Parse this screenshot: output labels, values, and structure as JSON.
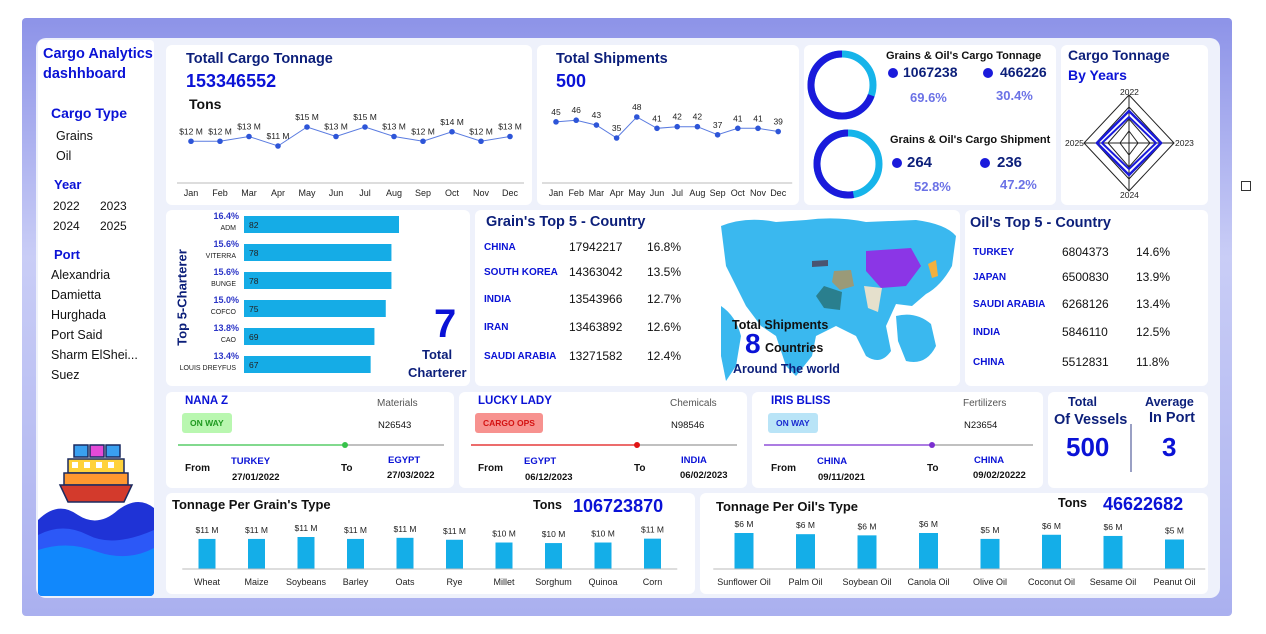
{
  "sidebar": {
    "title_line1": "Cargo Analytics",
    "title_line2": "dashhboard",
    "cargo_type_label": "Cargo Type",
    "cargo_types": [
      "Grains",
      "Oil"
    ],
    "year_label": "Year",
    "years": [
      "2022",
      "2023",
      "2024",
      "2025"
    ],
    "port_label": "Port",
    "ports": [
      "Alexandria",
      "Damietta",
      "Hurghada",
      "Port Said",
      "Sharm ElShei...",
      "Suez"
    ]
  },
  "tonnage": {
    "title": "Totall Cargo Tonnage",
    "value": "153346552",
    "unit": "Tons",
    "months": [
      "Jan",
      "Feb",
      "Mar",
      "Apr",
      "May",
      "Jun",
      "Jul",
      "Aug",
      "Sep",
      "Oct",
      "Nov",
      "Dec"
    ],
    "point_labels": [
      "$12 M",
      "$12 M",
      "$13 M",
      "$11 M",
      "$15 M",
      "$13 M",
      "$15 M",
      "$13 M",
      "$12 M",
      "$14 M",
      "$12 M",
      "$13 M"
    ]
  },
  "shipments": {
    "title": "Total Shipments",
    "value": "500",
    "months": [
      "Jan",
      "Feb",
      "Mar",
      "Apr",
      "May",
      "Jun",
      "Jul",
      "Aug",
      "Sep",
      "Oct",
      "Nov",
      "Dec"
    ],
    "point_labels": [
      "45",
      "46",
      "43",
      "35",
      "48",
      "41",
      "42",
      "42",
      "37",
      "41",
      "41",
      "39"
    ]
  },
  "donuts": {
    "tonnage_title": "Grains & Oil's Cargo Tonnage",
    "tonnage_grains": "1067238",
    "tonnage_oil": "466226",
    "tonnage_grains_pct": "69.6%",
    "tonnage_oil_pct": "30.4%",
    "shipment_title": "Grains & Oil's Cargo Shipment",
    "shipment_grains": "264",
    "shipment_oil": "236",
    "shipment_grains_pct": "52.8%",
    "shipment_oil_pct": "47.2%",
    "colors": {
      "grains": "#1a1adb",
      "oil": "#16b4ea"
    }
  },
  "years_radar": {
    "title_line1": "Cargo Tonnage",
    "title_line2": "By Years",
    "labels": [
      "2022",
      "2023",
      "2024",
      "2025"
    ]
  },
  "charterer": {
    "axis_title": "Top 5-Charterer",
    "rows": [
      {
        "pct": "16.4%",
        "name": "ADM",
        "value": "82"
      },
      {
        "pct": "15.6%",
        "name": "VITERRA",
        "value": "78"
      },
      {
        "pct": "15.6%",
        "name": "BUNGE",
        "value": "78"
      },
      {
        "pct": "15.0%",
        "name": "COFCO",
        "value": "75"
      },
      {
        "pct": "13.8%",
        "name": "CAO",
        "value": "69"
      },
      {
        "pct": "13.4%",
        "name": "LOUIS DREYFUS",
        "value": "67"
      }
    ],
    "total_value": "7",
    "total_label_line1": "Total",
    "total_label_line2": "Charterer"
  },
  "grain_top": {
    "title": "Grain's Top 5 - Country",
    "rows": [
      {
        "country": "CHINA",
        "value": "17942217",
        "pct": "16.8%"
      },
      {
        "country": "SOUTH KOREA",
        "value": "14363042",
        "pct": "13.5%"
      },
      {
        "country": "INDIA",
        "value": "13543966",
        "pct": "12.7%"
      },
      {
        "country": "IRAN",
        "value": "13463892",
        "pct": "12.6%"
      },
      {
        "country": "SAUDI ARABIA",
        "value": "13271582",
        "pct": "12.4%"
      }
    ]
  },
  "map": {
    "line1": "Total Shipments",
    "count": "8",
    "count_label": "Countries",
    "line3": "Around The world"
  },
  "oil_top": {
    "title": "Oil's Top 5 - Country",
    "rows": [
      {
        "country": "TURKEY",
        "value": "6804373",
        "pct": "14.6%"
      },
      {
        "country": "JAPAN",
        "value": "6500830",
        "pct": "13.9%"
      },
      {
        "country": "SAUDI ARABIA",
        "value": "6268126",
        "pct": "13.4%"
      },
      {
        "country": "INDIA",
        "value": "5846110",
        "pct": "12.5%"
      },
      {
        "country": "CHINA",
        "value": "5512831",
        "pct": "11.8%"
      }
    ]
  },
  "vessels": [
    {
      "name": "NANA Z",
      "category": "Materials",
      "status": "ON WAY",
      "id": "N26543",
      "from_label": "From",
      "from": "TURKEY",
      "from_date": "27/01/2022",
      "to_label": "To",
      "to": "EGYPT",
      "to_date": "27/03/2022",
      "color": "#37c24a"
    },
    {
      "name": "LUCKY LADY",
      "category": "Chemicals",
      "status": "CARGO OPS",
      "id": "N98546",
      "from_label": "From",
      "from": "EGYPT",
      "from_date": "06/12/2023",
      "to_label": "To",
      "to": "INDIA",
      "to_date": "06/02/2023",
      "color": "#e11414"
    },
    {
      "name": "IRIS BLISS",
      "category": "Fertilizers",
      "status": "ON WAY",
      "id": "N23654",
      "from_label": "From",
      "from": "CHINA",
      "from_date": "09/11/2021",
      "to_label": "To",
      "to": "CHINA",
      "to_date": "09/02/20222",
      "color": "#7b2fd0"
    }
  ],
  "kpis": {
    "total_label_line1": "Total",
    "total_label_line2": "Of Vessels",
    "total_value": "500",
    "avg_label_line1": "Average",
    "avg_label_line2": "In Port",
    "avg_value": "3"
  },
  "grain_types": {
    "title": "Tonnage Per Grain's Type",
    "tons_label": "Tons",
    "tons_value": "106723870",
    "categories": [
      "Wheat",
      "Maize",
      "Soybeans",
      "Barley",
      "Oats",
      "Rye",
      "Millet",
      "Sorghum",
      "Quinoa",
      "Corn"
    ],
    "labels": [
      "$11 M",
      "$11 M",
      "$11 M",
      "$11 M",
      "$11 M",
      "$11 M",
      "$10 M",
      "$10 M",
      "$10 M",
      "$11 M"
    ],
    "values": [
      10.9,
      10.9,
      11.6,
      10.9,
      11.3,
      10.6,
      9.6,
      9.4,
      9.6,
      11.0
    ]
  },
  "oil_types": {
    "title": "Tonnage Per Oil's Type",
    "tons_label": "Tons",
    "tons_value": "46622682",
    "categories": [
      "Sunflower Oil",
      "Palm Oil",
      "Soybean Oil",
      "Canola Oil",
      "Olive Oil",
      "Coconut Oil",
      "Sesame Oil",
      "Peanut Oil"
    ],
    "labels": [
      "$6 M",
      "$6 M",
      "$6 M",
      "$6 M",
      "$5 M",
      "$6 M",
      "$6 M",
      "$5 M"
    ],
    "values": [
      6.1,
      5.9,
      5.7,
      6.1,
      5.1,
      5.8,
      5.6,
      5.0
    ]
  },
  "chart_data": [
    {
      "type": "line",
      "title": "Totall Cargo Tonnage",
      "x": [
        "Jan",
        "Feb",
        "Mar",
        "Apr",
        "May",
        "Jun",
        "Jul",
        "Aug",
        "Sep",
        "Oct",
        "Nov",
        "Dec"
      ],
      "series": [
        {
          "values": [
            12,
            12,
            13,
            11,
            15,
            13,
            15,
            13,
            12,
            14,
            12,
            13
          ]
        }
      ],
      "data_labels": [
        "$12 M",
        "$12 M",
        "$13 M",
        "$11 M",
        "$15 M",
        "$13 M",
        "$15 M",
        "$13 M",
        "$12 M",
        "$14 M",
        "$12 M",
        "$13 M"
      ],
      "grid": false
    },
    {
      "type": "line",
      "title": "Total Shipments",
      "x": [
        "Jan",
        "Feb",
        "Mar",
        "Apr",
        "May",
        "Jun",
        "Jul",
        "Aug",
        "Sep",
        "Oct",
        "Nov",
        "Dec"
      ],
      "series": [
        {
          "values": [
            45,
            46,
            43,
            35,
            48,
            41,
            42,
            42,
            37,
            41,
            41,
            39
          ]
        }
      ],
      "grid": false
    },
    {
      "type": "pie",
      "title": "Grains & Oil's Cargo Tonnage",
      "values": [
        1067238,
        466226
      ],
      "percent_labels": [
        "69.6%",
        "30.4%"
      ]
    },
    {
      "type": "pie",
      "title": "Grains & Oil's Cargo Shipment",
      "values": [
        264,
        236
      ],
      "percent_labels": [
        "52.8%",
        "47.2%"
      ]
    },
    {
      "type": "bar",
      "title": "Top 5-Charterer",
      "categories": [
        "ADM",
        "VITERRA",
        "BUNGE",
        "COFCO",
        "CAO",
        "LOUIS DREYFUS"
      ],
      "values": [
        82,
        78,
        78,
        75,
        69,
        67
      ],
      "percent_labels": [
        "16.4%",
        "15.6%",
        "15.6%",
        "15.0%",
        "13.8%",
        "13.4%"
      ],
      "orientation": "horizontal"
    },
    {
      "type": "bar",
      "title": "Tonnage Per Grain's Type",
      "categories": [
        "Wheat",
        "Maize",
        "Soybeans",
        "Barley",
        "Oats",
        "Rye",
        "Millet",
        "Sorghum",
        "Quinoa",
        "Corn"
      ],
      "values": [
        10.9,
        10.9,
        11.6,
        10.9,
        11.3,
        10.6,
        9.6,
        9.4,
        9.6,
        11.0
      ],
      "data_labels": [
        "$11 M",
        "$11 M",
        "$11 M",
        "$11 M",
        "$11 M",
        "$11 M",
        "$10 M",
        "$10 M",
        "$10 M",
        "$11 M"
      ]
    },
    {
      "type": "bar",
      "title": "Tonnage Per Oil's Type",
      "categories": [
        "Sunflower Oil",
        "Palm Oil",
        "Soybean Oil",
        "Canola Oil",
        "Olive Oil",
        "Coconut Oil",
        "Sesame Oil",
        "Peanut Oil"
      ],
      "values": [
        6.1,
        5.9,
        5.7,
        6.1,
        5.1,
        5.8,
        5.6,
        5.0
      ],
      "data_labels": [
        "$6 M",
        "$6 M",
        "$6 M",
        "$6 M",
        "$5 M",
        "$6 M",
        "$6 M",
        "$5 M"
      ]
    }
  ]
}
